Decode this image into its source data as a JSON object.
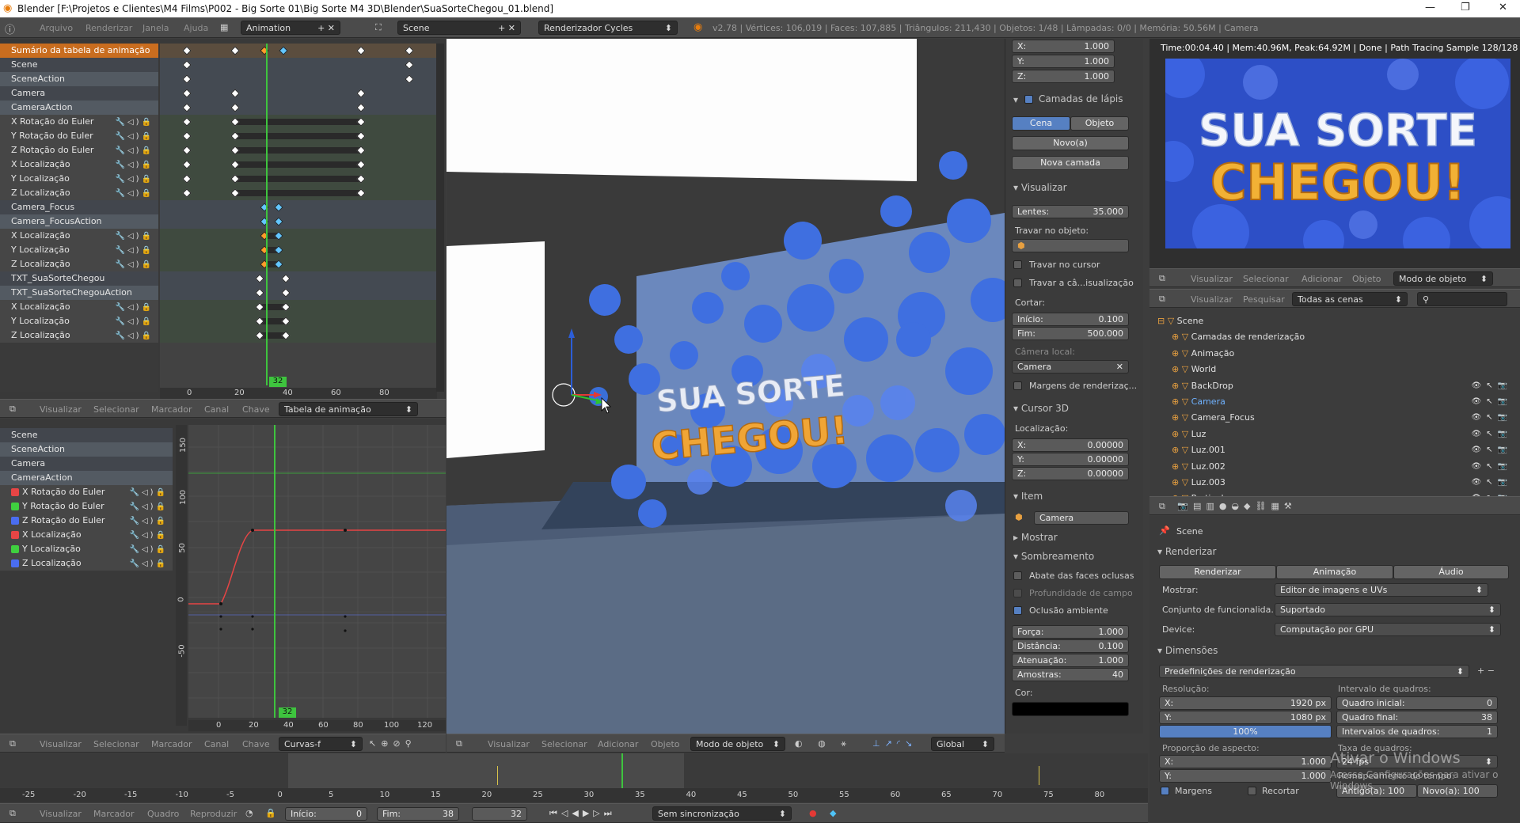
{
  "window": {
    "title": "Blender [F:\\Projetos e Clientes\\M4 Films\\P002 - Big Sorte 01\\Big Sorte M4 3D\\Blender\\SuaSorteChegou_01.blend]",
    "min": "—",
    "max": "❐",
    "close": "✕"
  },
  "infobar": {
    "menus": [
      "Arquivo",
      "Renderizar",
      "Janela",
      "Ajuda"
    ],
    "screen": "Animation",
    "scene": "Scene",
    "engine": "Renderizador Cycles",
    "stats": "v2.78 | Vértices: 106,019 | Faces: 107,885 | Triângulos: 211,430 | Objetos: 1/48 | Lâmpadas: 0/0 | Memória: 50.56M | Camera"
  },
  "dopesheet": {
    "channels": [
      {
        "label": "Sumário da tabela de animação",
        "kind": "sum"
      },
      {
        "label": "Scene",
        "kind": "obj"
      },
      {
        "label": "SceneAction",
        "kind": "act"
      },
      {
        "label": "Camera",
        "kind": "obj"
      },
      {
        "label": "CameraAction",
        "kind": "act"
      },
      {
        "label": "X Rotação do Euler",
        "kind": "fc"
      },
      {
        "label": "Y Rotação do Euler",
        "kind": "fc"
      },
      {
        "label": "Z Rotação do Euler",
        "kind": "fc"
      },
      {
        "label": "X Localização",
        "kind": "fc"
      },
      {
        "label": "Y Localização",
        "kind": "fc"
      },
      {
        "label": "Z Localização",
        "kind": "fc"
      },
      {
        "label": "Camera_Focus",
        "kind": "obj"
      },
      {
        "label": "Camera_FocusAction",
        "kind": "act"
      },
      {
        "label": "X Localização",
        "kind": "fc"
      },
      {
        "label": "Y Localização",
        "kind": "fc"
      },
      {
        "label": "Z Localização",
        "kind": "fc"
      },
      {
        "label": "TXT_SuaSorteChegou",
        "kind": "obj"
      },
      {
        "label": "TXT_SuaSorteChegouAction",
        "kind": "act"
      },
      {
        "label": "X Localização",
        "kind": "fc"
      },
      {
        "label": "Y Localização",
        "kind": "fc"
      },
      {
        "label": "Z Localização",
        "kind": "fc"
      }
    ],
    "frame": "32",
    "ticks": [
      "0",
      "20",
      "40",
      "60",
      "80"
    ],
    "header": {
      "menus": [
        "Visualizar",
        "Selecionar",
        "Marcador",
        "Canal",
        "Chave"
      ],
      "mode": "Tabela de animação"
    }
  },
  "graph": {
    "channels": [
      {
        "label": "Scene",
        "kind": "obj"
      },
      {
        "label": "SceneAction",
        "kind": "act"
      },
      {
        "label": "Camera",
        "kind": "obj"
      },
      {
        "label": "CameraAction",
        "kind": "act"
      },
      {
        "label": "X Rotação do Euler",
        "kind": "fc",
        "color": "#e64545"
      },
      {
        "label": "Y Rotação do Euler",
        "kind": "fc",
        "color": "#3fcf3f"
      },
      {
        "label": "Z Rotação do Euler",
        "kind": "fc",
        "color": "#4a6df0"
      },
      {
        "label": "X Localização",
        "kind": "fc",
        "color": "#e64545"
      },
      {
        "label": "Y Localização",
        "kind": "fc",
        "color": "#3fcf3f"
      },
      {
        "label": "Z Localização",
        "kind": "fc",
        "color": "#4a6df0"
      }
    ],
    "frame": "32",
    "xticks": [
      "0",
      "20",
      "40",
      "60",
      "80",
      "100",
      "120"
    ],
    "yticks": [
      "150",
      "100",
      "50",
      "0",
      "-50"
    ],
    "header": {
      "menus": [
        "Visualizar",
        "Selecionar",
        "Marcador",
        "Canal",
        "Chave"
      ],
      "mode": "Curvas-f"
    }
  },
  "viewport": {
    "header": {
      "menus": [
        "Visualizar",
        "Selecionar",
        "Adicionar",
        "Objeto"
      ],
      "mode": "Modo de objeto",
      "orient": "Global"
    },
    "text1": "SUA SORTE",
    "text2": "CHEGOU!"
  },
  "props": {
    "top": [
      {
        "k": "X:",
        "v": "1.000"
      },
      {
        "k": "Y:",
        "v": "1.000"
      },
      {
        "k": "Z:",
        "v": "1.000"
      }
    ],
    "gp": {
      "title": "Camadas de lápis",
      "tab1": "Cena",
      "tab2": "Objeto",
      "new": "Novo(a)",
      "newlayer": "Nova camada"
    },
    "view": {
      "title": "Visualizar",
      "lens": "Lentes:",
      "lensv": "35.000",
      "lock": "Travar no objeto:",
      "lockcursor": "Travar no cursor",
      "lockcam": "Travar a câ...isualização",
      "clip": "Cortar:",
      "start": "Início:",
      "startv": "0.100",
      "end": "Fim:",
      "endv": "500.000",
      "localcam": "Câmera local:",
      "cam": "Camera",
      "margins": "Margens de renderizaç..."
    },
    "cursor": {
      "title": "Cursor 3D",
      "loc": "Localização:",
      "x": "X:",
      "xv": "0.00000",
      "y": "Y:",
      "yv": "0.00000",
      "z": "Z:",
      "zv": "0.00000"
    },
    "item": {
      "title": "Item",
      "name": "Camera"
    },
    "show": "Mostrar",
    "shading": {
      "title": "Sombreamento",
      "backface": "Abate das faces oclusas",
      "dof": "Profundidade de campo",
      "ao": "Oclusão ambiente",
      "force": "Força:",
      "forcev": "1.000",
      "dist": "Distância:",
      "distv": "0.100",
      "att": "Atenuação:",
      "attv": "1.000",
      "samples": "Amostras:",
      "samplesv": "40",
      "color": "Cor:"
    }
  },
  "render": {
    "info": "Time:00:04.40 | Mem:40.96M, Peak:64.92M | Done | Path Tracing Sample 128/128",
    "text1": "SUA SORTE",
    "text2": "CHEGOU!",
    "header": {
      "menus": [
        "Visualizar",
        "Selecionar",
        "Adicionar",
        "Objeto"
      ],
      "mode": "Modo de objeto"
    }
  },
  "outliner": {
    "header": {
      "menus": [
        "Visualizar",
        "Pesquisar"
      ],
      "filter": "Todas as cenas"
    },
    "items": [
      {
        "label": "Scene",
        "indent": 0
      },
      {
        "label": "Camadas de renderização",
        "indent": 1
      },
      {
        "label": "Animação",
        "indent": 1
      },
      {
        "label": "World",
        "indent": 1
      },
      {
        "label": "BackDrop",
        "indent": 1
      },
      {
        "label": "Camera",
        "indent": 1,
        "sel": true
      },
      {
        "label": "Camera_Focus",
        "indent": 1
      },
      {
        "label": "Luz",
        "indent": 1
      },
      {
        "label": "Luz.001",
        "indent": 1
      },
      {
        "label": "Luz.002",
        "indent": 1
      },
      {
        "label": "Luz.003",
        "indent": 1
      },
      {
        "label": "Particulas",
        "indent": 1
      }
    ]
  },
  "renderprops": {
    "scene": "Scene",
    "render": "Renderizar",
    "b1": "Renderizar",
    "b2": "Animação",
    "b3": "Áudio",
    "display": "Mostrar:",
    "displayv": "Editor de imagens e UVs",
    "featset": "Conjunto de funcionalida...",
    "featv": "Suportado",
    "device": "Device:",
    "devicev": "Computação por GPU",
    "dims": "Dimensões",
    "presets": "Predefinições de renderização",
    "res": "Resolução:",
    "rx": "X:",
    "rxv": "1920 px",
    "ry": "Y:",
    "ryv": "1080 px",
    "pct": "100%",
    "range": "Intervalo de quadros:",
    "fs": "Quadro inicial:",
    "fsv": "0",
    "fe": "Quadro final:",
    "fev": "38",
    "step": "Intervalos de quadros:",
    "stepv": "1",
    "aspect": "Proporção de aspecto:",
    "ax": "X:",
    "axv": "1.000",
    "ay": "Y:",
    "ayv": "1.000",
    "fpslbl": "Taxa de quadros:",
    "fps": "24 fps",
    "remap": "Remapeamento de tempo:",
    "old": "Antigo(a): 100",
    "new": "Novo(a): 100",
    "margins": "Margens",
    "crop": "Recortar"
  },
  "watermark": {
    "t1": "Ativar o Windows",
    "t2": "Acesse Configurações para ativar o Windows."
  },
  "timeline": {
    "ticks": [
      "-25",
      "-20",
      "-15",
      "-10",
      "-5",
      "0",
      "5",
      "10",
      "15",
      "20",
      "25",
      "30",
      "35",
      "40",
      "45",
      "50",
      "55",
      "60",
      "65",
      "70",
      "75",
      "80"
    ],
    "footer": {
      "menus": [
        "Visualizar",
        "Marcador",
        "Quadro",
        "Reproduzir"
      ],
      "start": "Início:",
      "startv": "0",
      "end": "Fim:",
      "endv": "38",
      "cur": "32",
      "sync": "Sem sincronização"
    }
  }
}
